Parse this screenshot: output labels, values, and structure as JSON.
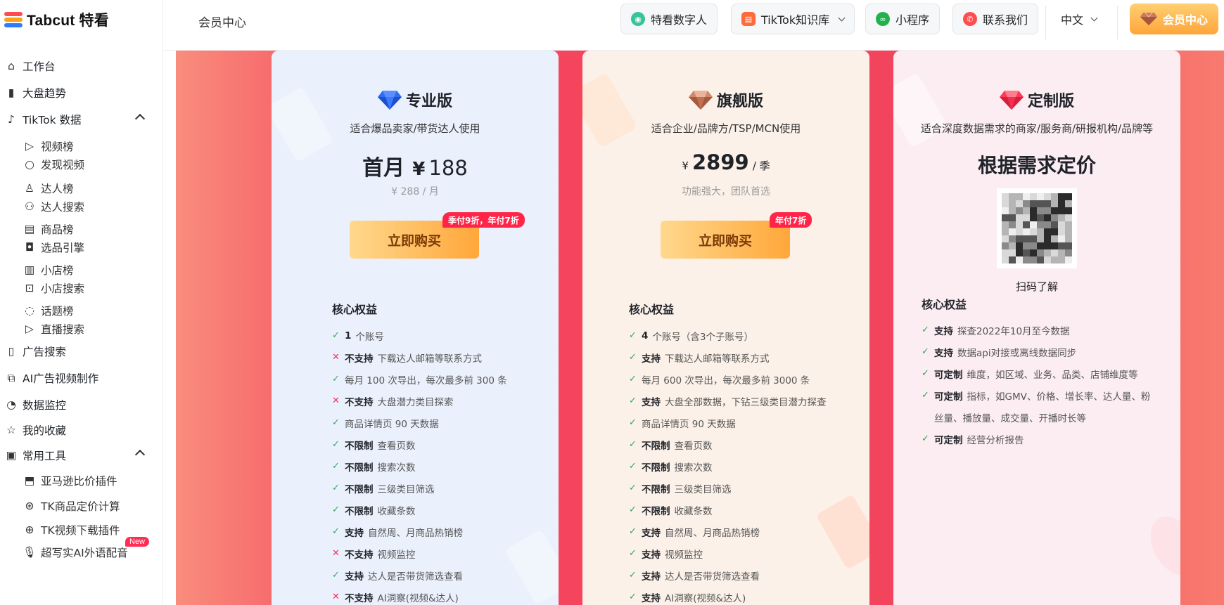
{
  "brand": {
    "name": "Tabcut 特看"
  },
  "sidebar": {
    "items": [
      {
        "label": "工作台",
        "icon": "home-icon"
      },
      {
        "label": "大盘趋势",
        "icon": "bar-chart-icon"
      },
      {
        "label": "TikTok 数据",
        "icon": "tiktok-icon",
        "expanded": true
      },
      {
        "label": "视频榜",
        "icon": "video-icon"
      },
      {
        "label": "发现视频",
        "icon": "circle-icon"
      },
      {
        "label": "达人榜",
        "icon": "user-icon"
      },
      {
        "label": "达人搜索",
        "icon": "user-search-icon"
      },
      {
        "label": "商品榜",
        "icon": "store-icon"
      },
      {
        "label": "选品引擎",
        "icon": "bag-icon"
      },
      {
        "label": "小店榜",
        "icon": "shop-icon"
      },
      {
        "label": "小店搜索",
        "icon": "shop-search-icon"
      },
      {
        "label": "话题榜",
        "icon": "chat-icon"
      },
      {
        "label": "直播搜索",
        "icon": "play-icon"
      },
      {
        "label": "广告搜索",
        "icon": "ad-icon"
      },
      {
        "label": "AI广告视频制作",
        "icon": "ai-video-icon"
      },
      {
        "label": "数据监控",
        "icon": "monitor-icon"
      },
      {
        "label": "我的收藏",
        "icon": "star-icon"
      },
      {
        "label": "常用工具",
        "icon": "toolbox-icon",
        "expanded": true
      },
      {
        "label": "亚马逊比价插件",
        "icon": "plugin-icon"
      },
      {
        "label": "TK商品定价计算",
        "icon": "price-icon"
      },
      {
        "label": "TK视频下载插件",
        "icon": "download-icon"
      },
      {
        "label": "超写实AI外语配音",
        "icon": "mic-icon",
        "badge": "New"
      }
    ]
  },
  "header": {
    "title": "会员中心",
    "buttons": [
      {
        "label": "特看数字人",
        "icon": "digital-human-icon"
      },
      {
        "label": "TikTok知识库",
        "icon": "book-icon"
      },
      {
        "label": "小程序",
        "icon": "mini-program-icon"
      },
      {
        "label": "联系我们",
        "icon": "contact-icon"
      }
    ],
    "language": "中文",
    "vip_label": "会员中心"
  },
  "plans": {
    "pro": {
      "name": "专业版",
      "desc": "适合爆品卖家/带货达人使用",
      "price_prefix": "首月",
      "currency": "¥",
      "price": "188",
      "price_sub": "¥ 288 / 月",
      "buy_label": "立即购买",
      "promo": "季付9折，年付7折",
      "core_title": "核心权益",
      "features": [
        {
          "ok": true,
          "strong": "1",
          "text": "个账号"
        },
        {
          "ok": false,
          "strong": "不支持",
          "text": "下载达人邮箱等联系方式"
        },
        {
          "ok": true,
          "strong": "",
          "text": "每月 100 次导出，每次最多前 300 条"
        },
        {
          "ok": false,
          "strong": "不支持",
          "text": "大盘潜力类目探索"
        },
        {
          "ok": true,
          "strong": "",
          "text": "商品详情页 90 天数据"
        },
        {
          "ok": true,
          "strong": "不限制",
          "text": "查看页数"
        },
        {
          "ok": true,
          "strong": "不限制",
          "text": "搜索次数"
        },
        {
          "ok": true,
          "strong": "不限制",
          "text": "三级类目筛选"
        },
        {
          "ok": true,
          "strong": "不限制",
          "text": "收藏条数"
        },
        {
          "ok": true,
          "strong": "支持",
          "text": "自然周、月商品热销榜"
        },
        {
          "ok": false,
          "strong": "不支持",
          "text": "视频监控"
        },
        {
          "ok": true,
          "strong": "支持",
          "text": "达人是否带货筛选查看"
        },
        {
          "ok": false,
          "strong": "不支持",
          "text": "AI洞察(视频&达人)"
        }
      ]
    },
    "flagship": {
      "name": "旗舰版",
      "desc": "适合企业/品牌方/TSP/MCN使用",
      "currency": "¥",
      "price": "2899",
      "price_unit": "/ 季",
      "price_sub": "功能强大，团队首选",
      "buy_label": "立即购买",
      "promo": "年付7折",
      "core_title": "核心权益",
      "features": [
        {
          "ok": true,
          "strong": "4",
          "text": "个账号（含3个子账号）"
        },
        {
          "ok": true,
          "strong": "支持",
          "text": "下载达人邮箱等联系方式"
        },
        {
          "ok": true,
          "strong": "",
          "text": "每月 600 次导出，每次最多前 3000 条"
        },
        {
          "ok": true,
          "strong": "支持",
          "text": "大盘全部数据，下钻三级类目潜力探查"
        },
        {
          "ok": true,
          "strong": "",
          "text": "商品详情页 90 天数据"
        },
        {
          "ok": true,
          "strong": "不限制",
          "text": "查看页数"
        },
        {
          "ok": true,
          "strong": "不限制",
          "text": "搜索次数"
        },
        {
          "ok": true,
          "strong": "不限制",
          "text": "三级类目筛选"
        },
        {
          "ok": true,
          "strong": "不限制",
          "text": "收藏条数"
        },
        {
          "ok": true,
          "strong": "支持",
          "text": "自然周、月商品热销榜"
        },
        {
          "ok": true,
          "strong": "支持",
          "text": "视频监控"
        },
        {
          "ok": true,
          "strong": "支持",
          "text": "达人是否带货筛选查看"
        },
        {
          "ok": true,
          "strong": "支持",
          "text": "AI洞察(视频&达人)"
        }
      ]
    },
    "custom": {
      "name": "定制版",
      "desc": "适合深度数据需求的商家/服务商/研报机构/品牌等",
      "price_text": "根据需求定价",
      "qr_caption": "扫码了解",
      "core_title": "核心权益",
      "features": [
        {
          "ok": true,
          "strong": "支持",
          "text": "探查2022年10月至今数据"
        },
        {
          "ok": true,
          "strong": "支持",
          "text": "数据api对接或离线数据同步"
        },
        {
          "ok": true,
          "strong": "可定制",
          "text": "维度，如区域、业务、品类、店铺维度等"
        },
        {
          "ok": true,
          "strong": "可定制",
          "text": "指标，如GMV、价格、增长率、达人量、粉"
        },
        {
          "ok": true,
          "strong": "",
          "text": "丝量、播放量、成交量、开播时长等"
        },
        {
          "ok": true,
          "strong": "可定制",
          "text": "经营分析报告"
        }
      ]
    }
  },
  "colors": {
    "accent_red": "#f2445c",
    "promo_red": "#ff2448",
    "buy_gradient_start": "#ffd88d",
    "buy_gradient_end": "#ffa73a",
    "check_green": "#2fa856"
  }
}
